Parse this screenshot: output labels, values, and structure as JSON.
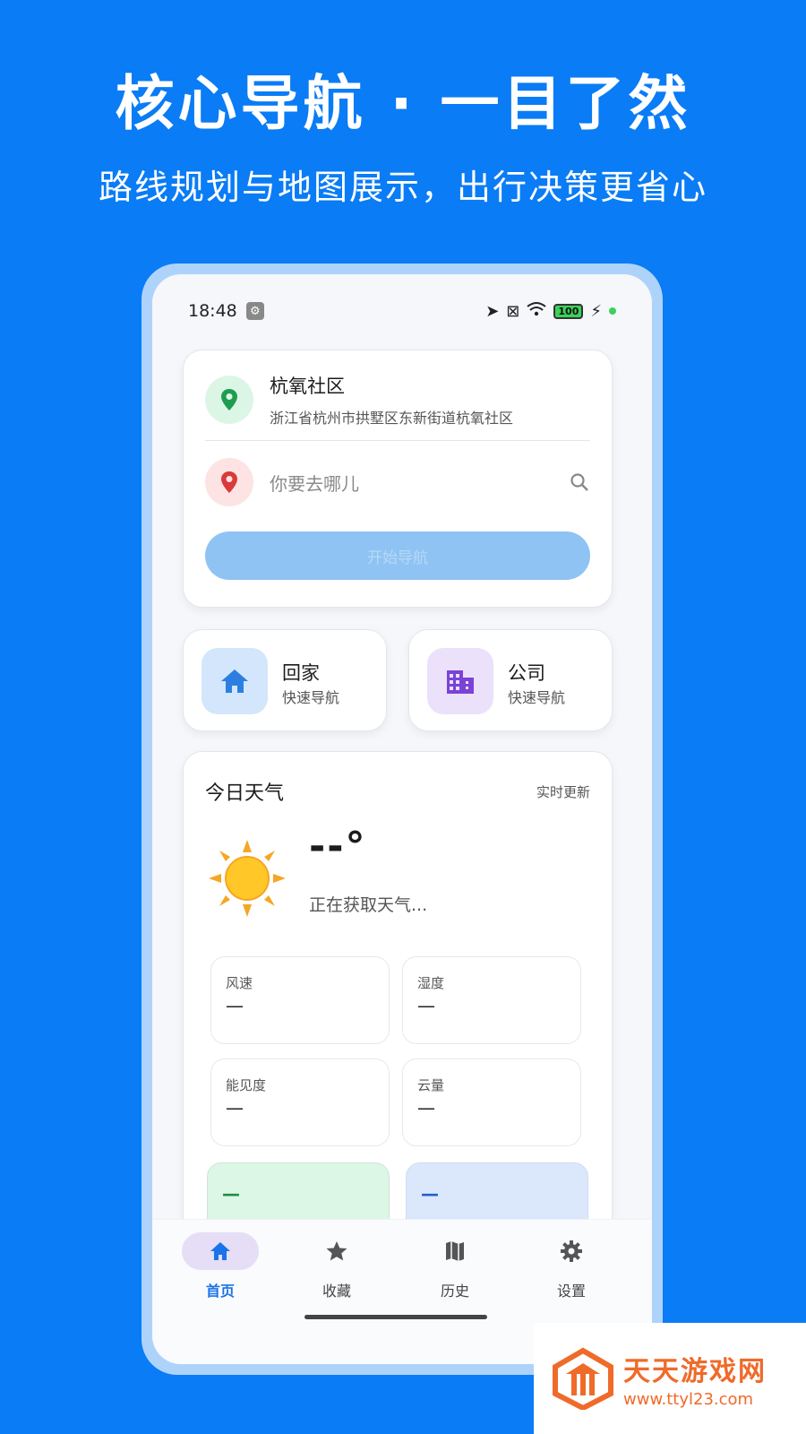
{
  "promo": {
    "headline": "核心导航 · 一目了然",
    "subline": "路线规划与地图展示，出行决策更省心"
  },
  "status_bar": {
    "time": "18:48",
    "battery": "100"
  },
  "route": {
    "origin_name": "杭氧社区",
    "origin_address": "浙江省杭州市拱墅区东新街道杭氧社区",
    "destination_placeholder": "你要去哪儿",
    "start_button": "开始导航"
  },
  "quick_nav": [
    {
      "title": "回家",
      "subtitle": "快速导航",
      "icon": "home-icon"
    },
    {
      "title": "公司",
      "subtitle": "快速导航",
      "icon": "office-building-icon"
    }
  ],
  "weather": {
    "title": "今日天气",
    "update_label": "实时更新",
    "temperature": "--°",
    "status": "正在获取天气...",
    "stats": [
      {
        "label": "风速",
        "value": "—"
      },
      {
        "label": "湿度",
        "value": "—"
      },
      {
        "label": "能见度",
        "value": "—"
      },
      {
        "label": "云量",
        "value": "—"
      }
    ],
    "bottom_values": [
      "—",
      "—"
    ]
  },
  "bottom_nav": [
    {
      "label": "首页",
      "icon": "home-icon",
      "active": true
    },
    {
      "label": "收藏",
      "icon": "star-icon",
      "active": false
    },
    {
      "label": "历史",
      "icon": "map-icon",
      "active": false
    },
    {
      "label": "设置",
      "icon": "gear-icon",
      "active": false
    }
  ],
  "watermark": {
    "title": "天天游戏网",
    "url": "www.ttyl23.com"
  },
  "colors": {
    "background": "#0a7cf5",
    "accent": "#1a73e8",
    "start_button": "#8fc3f3",
    "origin_pin": "#1e9d50",
    "destination_pin": "#d93a3a",
    "watermark": "#ef6b2a"
  }
}
